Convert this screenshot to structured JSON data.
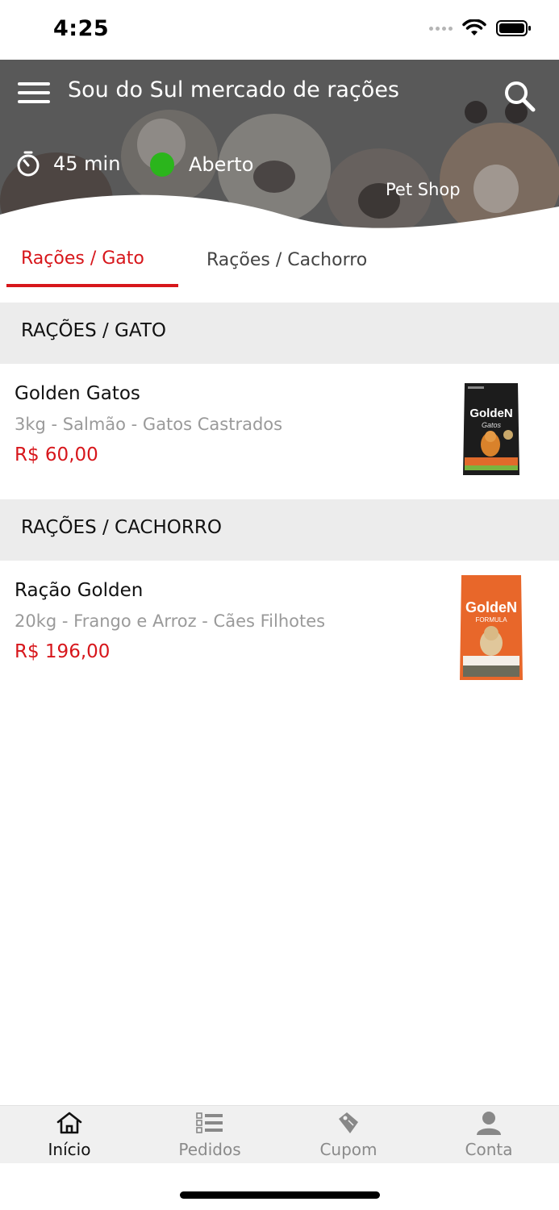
{
  "status_bar": {
    "time": "4:25"
  },
  "header": {
    "title": "Sou do Sul mercado de rações",
    "delivery_time": "45 min",
    "open_status": "Aberto",
    "category": "Pet Shop"
  },
  "tabs": [
    {
      "label": "Rações / Gato"
    },
    {
      "label": "Rações / Cachorro"
    }
  ],
  "sections": [
    {
      "title": "RAÇÕES / GATO",
      "products": [
        {
          "name": "Golden Gatos",
          "description": "3kg - Salmão - Gatos Castrados",
          "price": "R$ 60,00",
          "brand": "GoldeN",
          "sub": "Gatos"
        }
      ]
    },
    {
      "title": "RAÇÕES / CACHORRO",
      "products": [
        {
          "name": "Ração Golden",
          "description": "20kg - Frango e Arroz - Cães Filhotes",
          "price": "R$ 196,00",
          "brand": "GoldeN",
          "sub": "FORMULA"
        }
      ]
    }
  ],
  "bottom_nav": [
    {
      "label": "Início"
    },
    {
      "label": "Pedidos"
    },
    {
      "label": "Cupom"
    },
    {
      "label": "Conta"
    }
  ],
  "colors": {
    "accent": "#d7161b",
    "open_dot": "#2bb51c",
    "section_bg": "#ececec"
  }
}
